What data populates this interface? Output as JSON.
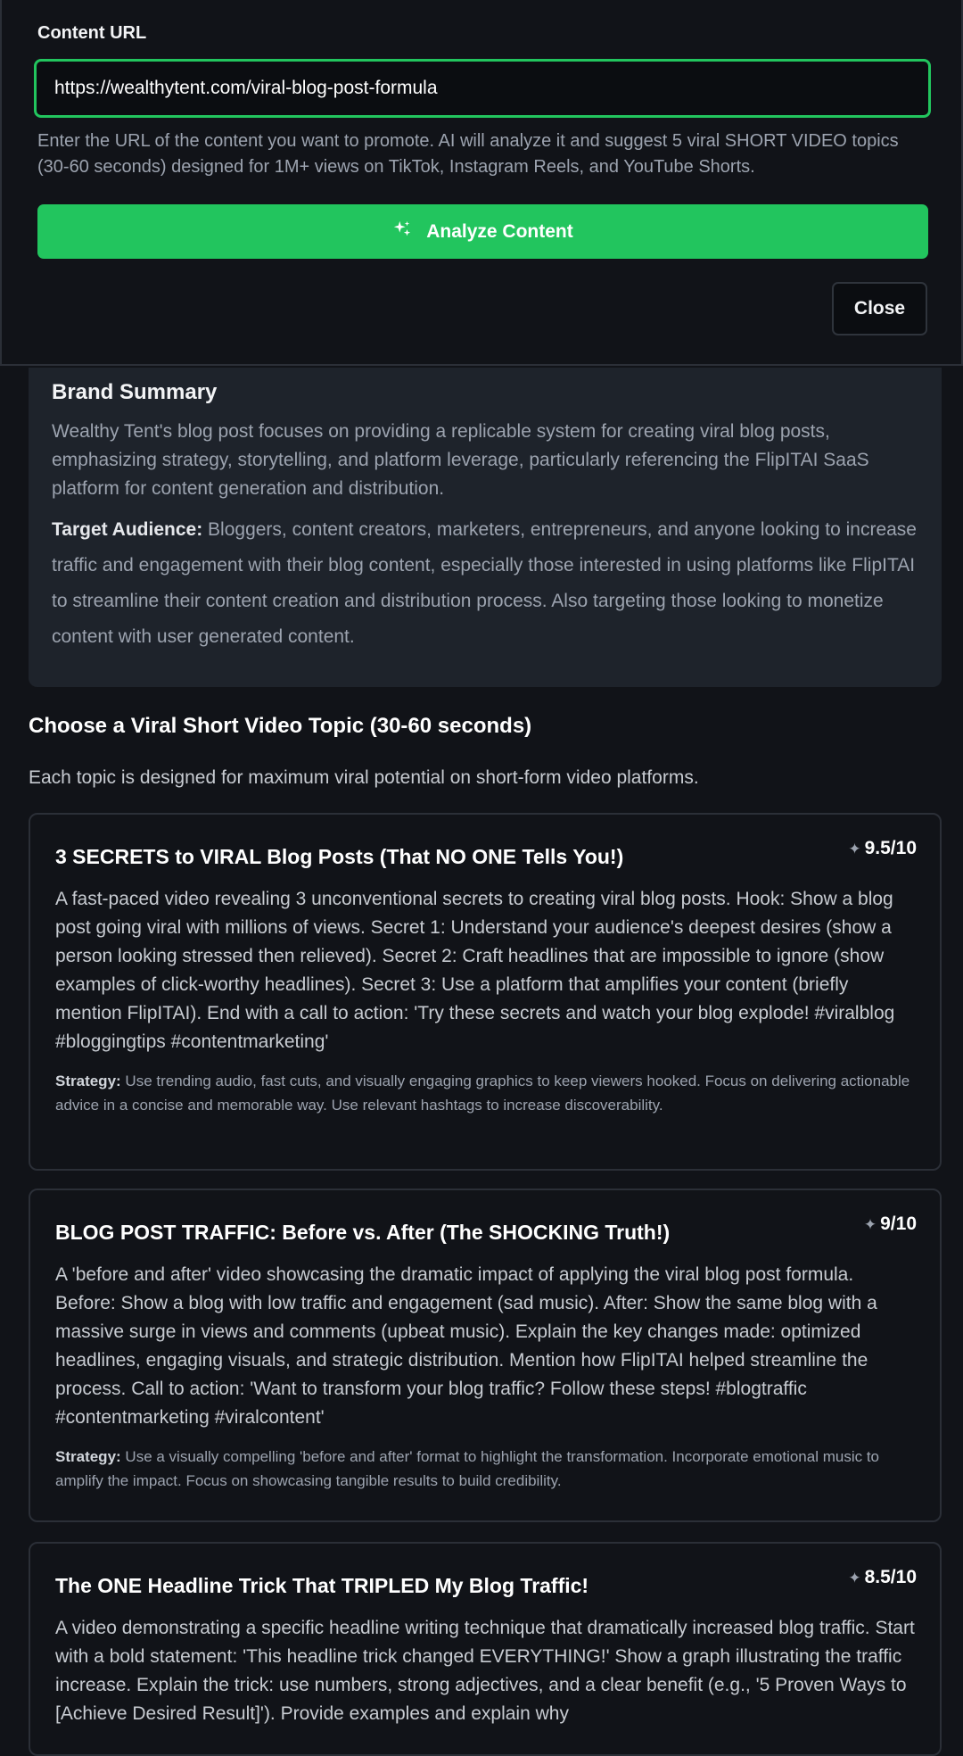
{
  "form": {
    "label": "Content URL",
    "url_value": "https://wealthytent.com/viral-blog-post-formula",
    "help": "Enter the URL of the content you want to promote. AI will analyze it and suggest 5 viral SHORT VIDEO topics (30-60 seconds) designed for 1M+ views on TikTok, Instagram Reels, and YouTube Shorts.",
    "analyze_label": "Analyze Content",
    "close_label": "Close"
  },
  "summary": {
    "title": "Brand Summary",
    "body": "Wealthy Tent's blog post focuses on providing a replicable system for creating viral blog posts, emphasizing strategy, storytelling, and platform leverage, particularly referencing the FlipITAI SaaS platform for content generation and distribution.",
    "audience_label": "Target Audience:",
    "audience": "Bloggers, content creators, marketers, entrepreneurs, and anyone looking to increase traffic and engagement with their blog content, especially those interested in using platforms like FlipITAI to streamline their content creation and distribution process. Also targeting those looking to monetize content with user generated content."
  },
  "topics_section": {
    "title": "Choose a Viral Short Video Topic (30-60 seconds)",
    "subtitle": "Each topic is designed for maximum viral potential on short-form video platforms."
  },
  "topics": [
    {
      "title": "3 SECRETS to VIRAL Blog Posts (That NO ONE Tells You!)",
      "score": "9.5/10",
      "description": "A fast-paced video revealing 3 unconventional secrets to creating viral blog posts. Hook: Show a blog post going viral with millions of views. Secret 1: Understand your audience's deepest desires (show a person looking stressed then relieved). Secret 2: Craft headlines that are impossible to ignore (show examples of click-worthy headlines). Secret 3: Use a platform that amplifies your content (briefly mention FlipITAI). End with a call to action: 'Try these secrets and watch your blog explode! #viralblog #bloggingtips #contentmarketing'",
      "strategy_label": "Strategy:",
      "strategy": "Use trending audio, fast cuts, and visually engaging graphics to keep viewers hooked. Focus on delivering actionable advice in a concise and memorable way. Use relevant hashtags to increase discoverability."
    },
    {
      "title": "BLOG POST TRAFFIC: Before vs. After (The SHOCKING Truth!)",
      "score": "9/10",
      "description": "A 'before and after' video showcasing the dramatic impact of applying the viral blog post formula. Before: Show a blog with low traffic and engagement (sad music). After: Show the same blog with a massive surge in views and comments (upbeat music). Explain the key changes made: optimized headlines, engaging visuals, and strategic distribution. Mention how FlipITAI helped streamline the process. Call to action: 'Want to transform your blog traffic? Follow these steps! #blogtraffic #contentmarketing #viralcontent'",
      "strategy_label": "Strategy:",
      "strategy": "Use a visually compelling 'before and after' format to highlight the transformation. Incorporate emotional music to amplify the impact. Focus on showcasing tangible results to build credibility."
    },
    {
      "title": "The ONE Headline Trick That TRIPLED My Blog Traffic!",
      "score": "8.5/10",
      "description": "A video demonstrating a specific headline writing technique that dramatically increased blog traffic. Start with a bold statement: 'This headline trick changed EVERYTHING!' Show a graph illustrating the traffic increase. Explain the trick: use numbers, strong adjectives, and a clear benefit (e.g., '5 Proven Ways to [Achieve Desired Result]'). Provide examples and explain why"
    }
  ]
}
